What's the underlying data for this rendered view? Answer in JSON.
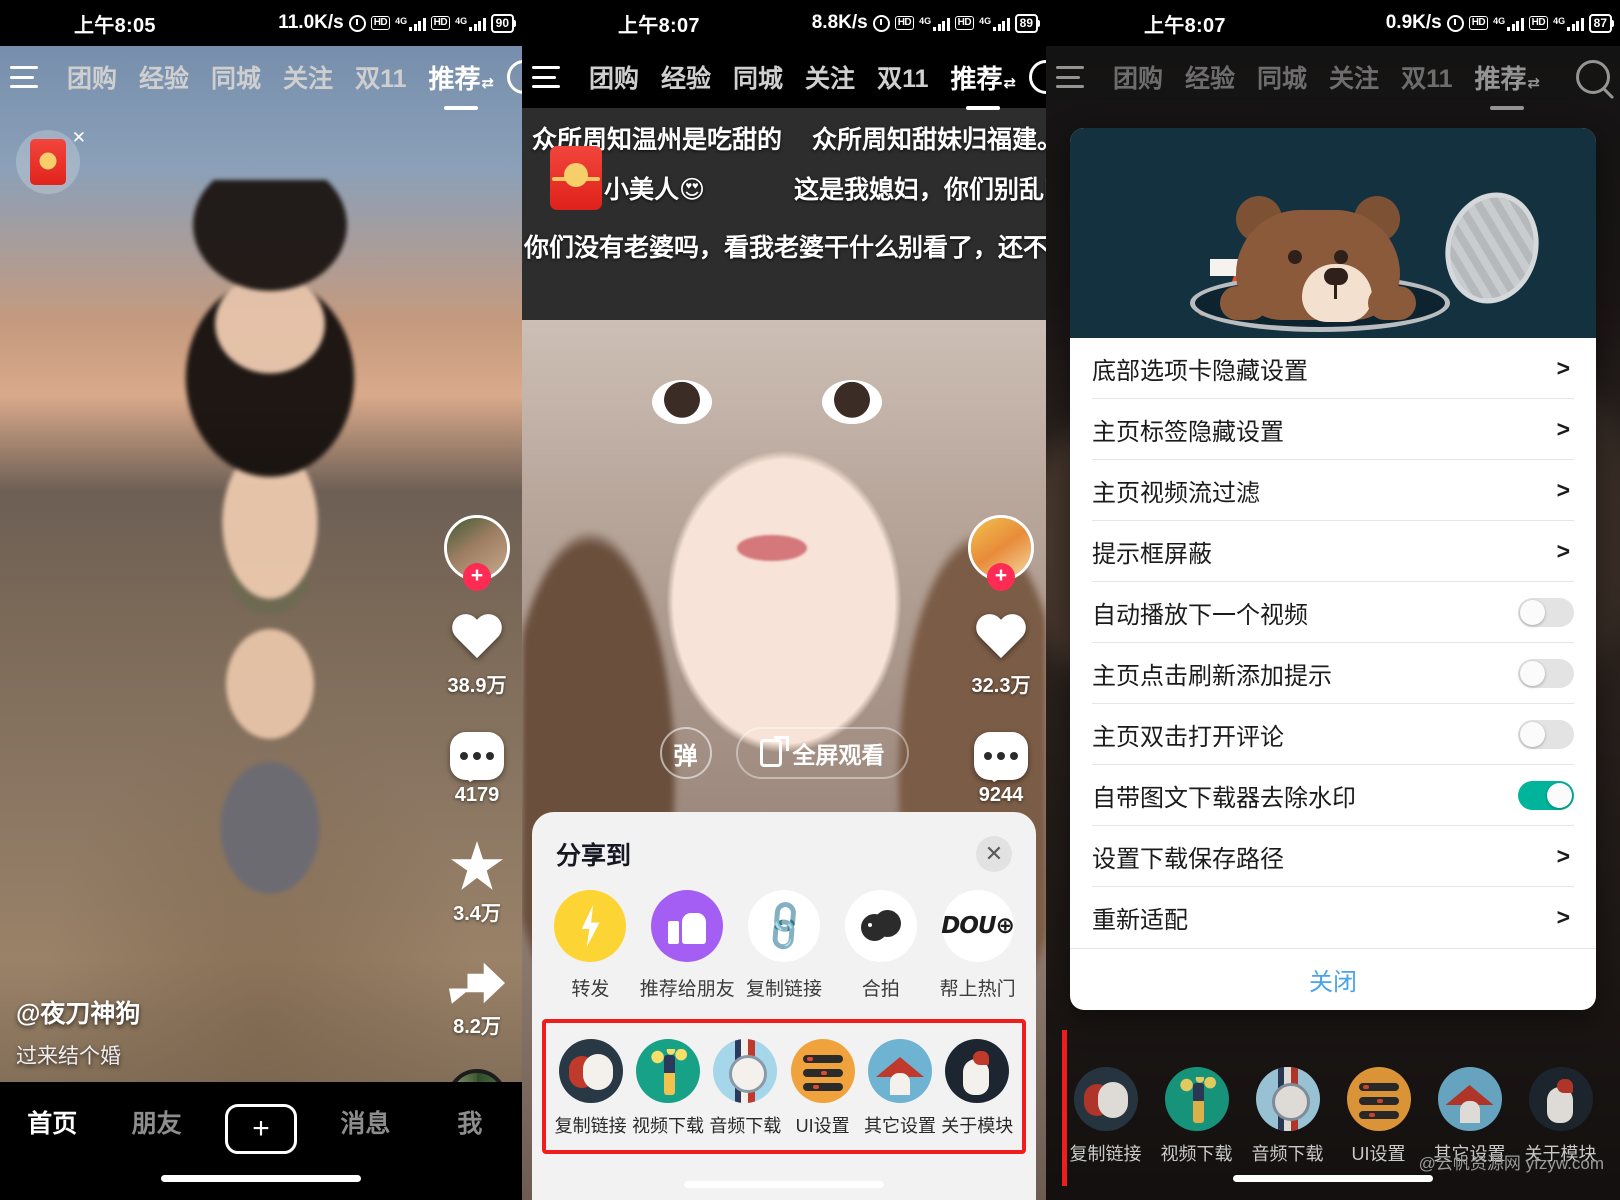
{
  "panels": [
    {
      "status": {
        "time": "上午8:05",
        "speed": "11.0K/s",
        "net1": "4G",
        "net2": "4G",
        "hd": "HD",
        "battery": "90"
      },
      "topnav": {
        "menu_icon": "hamburger-icon",
        "search_icon": "search-icon",
        "tabs": [
          "团购",
          "经验",
          "同城",
          "关注",
          "双11",
          "推荐"
        ],
        "active_tab": "推荐",
        "sort_glyph": "⇄"
      },
      "floater": {
        "name": "red-packet-widget",
        "close": "✕"
      },
      "rail": {
        "follow_plus": "+",
        "like_count": "38.9万",
        "comment_count": "4179",
        "favorite_count": "3.4万",
        "share_count": "8.2万"
      },
      "caption": {
        "user": "@夜刀神狗",
        "desc": "过来结个婚"
      },
      "tabbar": {
        "items": [
          "首页",
          "朋友",
          "+",
          "消息",
          "我"
        ],
        "active": "首页"
      }
    },
    {
      "status": {
        "time": "上午8:07",
        "speed": "8.8K/s",
        "net1": "4G",
        "net2": "4G",
        "hd": "HD",
        "battery": "89"
      },
      "topnav": {
        "menu_icon": "hamburger-icon",
        "search_icon": "search-icon",
        "tabs": [
          "团购",
          "经验",
          "同城",
          "关注",
          "双11",
          "推荐"
        ],
        "active_tab": "推荐",
        "sort_glyph": "⇄"
      },
      "danmaku": [
        "众所周知温州是吃甜的",
        "众所周知甜妹归福建。",
        "小美人😍",
        "这是我媳妇，你们别乱叫😭",
        "你们没有老婆吗，看我老婆干什么",
        "别看了，还不快补"
      ],
      "controls": {
        "danmaku_btn": "弹",
        "fullscreen_btn": "全屏观看"
      },
      "rail": {
        "follow_plus": "+",
        "like_count": "32.3万",
        "comment_count": "9244"
      },
      "sheet": {
        "title": "分享到",
        "close_icon": "close-icon",
        "share_items": [
          {
            "label": "转发",
            "icon": "flash-forward-icon",
            "color": "#fcd535"
          },
          {
            "label": "推荐给朋友",
            "icon": "thumbs-up-icon",
            "color": "#a45ef4"
          },
          {
            "label": "复制链接",
            "icon": "link-icon",
            "color": "#ffffff"
          },
          {
            "label": "合拍",
            "icon": "duet-faces-icon",
            "color": "#ffffff"
          },
          {
            "label": "帮上热门",
            "icon": "dou-plus-icon",
            "color": "#ffffff"
          }
        ],
        "module_items": [
          {
            "label": "复制链接",
            "icon": "theater-masks-icon"
          },
          {
            "label": "视频下载",
            "icon": "magic-wand-icon"
          },
          {
            "label": "音频下载",
            "icon": "pocket-watch-icon"
          },
          {
            "label": "UI设置",
            "icon": "settings-list-icon"
          },
          {
            "label": "其它设置",
            "icon": "house-icon"
          },
          {
            "label": "关于模块",
            "icon": "chicken-icon"
          }
        ],
        "highlight_color": "#f01d1d"
      }
    },
    {
      "status": {
        "time": "上午8:07",
        "speed": "0.9K/s",
        "net1": "4G",
        "net2": "4G",
        "hd": "HD",
        "battery": "87"
      },
      "topnav": {
        "menu_icon": "hamburger-icon",
        "search_icon": "search-icon",
        "tabs": [
          "团购",
          "经验",
          "同城",
          "关注",
          "双11",
          "推荐"
        ],
        "active_tab": "推荐",
        "sort_glyph": "⇄"
      },
      "dialog": {
        "hero_icon": "bear-in-manhole-illustration",
        "hero_bg": "#13313f",
        "rows": [
          {
            "label": "底部选项卡隐藏设置",
            "type": "arrow",
            "arrow": ">"
          },
          {
            "label": "主页标签隐藏设置",
            "type": "arrow",
            "arrow": ">"
          },
          {
            "label": "主页视频流过滤",
            "type": "arrow",
            "arrow": ">"
          },
          {
            "label": "提示框屏蔽",
            "type": "arrow",
            "arrow": ">"
          },
          {
            "label": "自动播放下一个视频",
            "type": "toggle",
            "on": false
          },
          {
            "label": "主页点击刷新添加提示",
            "type": "toggle",
            "on": false
          },
          {
            "label": "主页双击打开评论",
            "type": "toggle",
            "on": false
          },
          {
            "label": "自带图文下载器去除水印",
            "type": "toggle",
            "on": true
          },
          {
            "label": "设置下载保存路径",
            "type": "arrow",
            "arrow": ">"
          },
          {
            "label": "重新适配",
            "type": "arrow",
            "arrow": ">"
          }
        ],
        "close_label": "关闭",
        "close_color": "#4aa3e8",
        "toggle_on_color": "#00b39b"
      },
      "module_items": [
        {
          "label": "复制链接",
          "icon": "theater-masks-icon"
        },
        {
          "label": "视频下载",
          "icon": "magic-wand-icon"
        },
        {
          "label": "音频下载",
          "icon": "pocket-watch-icon"
        },
        {
          "label": "UI设置",
          "icon": "settings-list-icon"
        },
        {
          "label": "其它设置",
          "icon": "house-icon"
        },
        {
          "label": "关于模块",
          "icon": "chicken-icon"
        }
      ],
      "watermark": "@云帆资源网 yfzyw.com"
    }
  ]
}
